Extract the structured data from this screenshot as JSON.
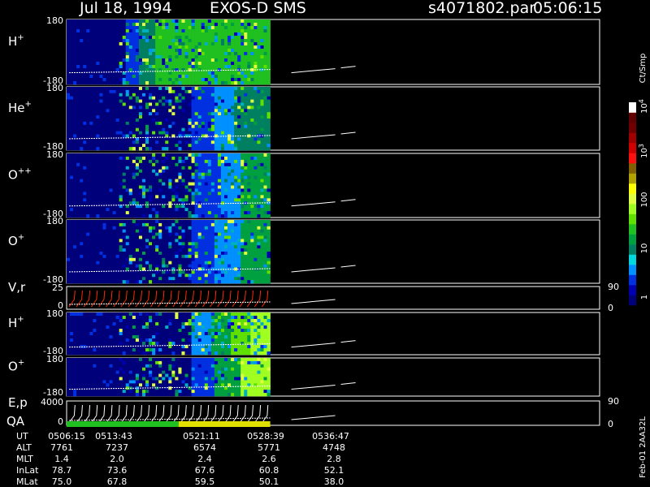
{
  "header": {
    "date": "Jul 18, 1994",
    "instrument": "EXOS-D SMS",
    "file": "s4071802.par",
    "time": "05:06:15"
  },
  "chart_data": {
    "type": "heatmap",
    "panels": [
      {
        "name": "H",
        "sup": "+",
        "ymax": "180",
        "ymin": "-180",
        "kind": "heat",
        "profile": "h1"
      },
      {
        "name": "He",
        "sup": "+",
        "ymax": "180",
        "ymin": "-180",
        "kind": "heat",
        "profile": "he"
      },
      {
        "name": "O",
        "sup": "++",
        "ymax": "180",
        "ymin": "-180",
        "kind": "heat",
        "profile": "opp"
      },
      {
        "name": "O",
        "sup": "+",
        "ymax": "180",
        "ymin": "-180",
        "kind": "heat",
        "profile": "op"
      },
      {
        "name": "V,r",
        "sup": "",
        "ymax": "25",
        "ymin": "0",
        "kind": "line",
        "right_top": "90",
        "right_bottom": "0"
      },
      {
        "name": "H",
        "sup": "+",
        "ymax": "180",
        "ymin": "-180",
        "kind": "heat",
        "profile": "h2"
      },
      {
        "name": "O",
        "sup": "+",
        "ymax": "180",
        "ymin": "-180",
        "kind": "heat",
        "profile": "o2"
      },
      {
        "name": "E,p",
        "sup": "",
        "ymax": "4000",
        "ymin": "0",
        "kind": "line",
        "right_top": "90",
        "right_bottom": "0"
      }
    ],
    "qa_label": "QA",
    "colorbar": {
      "unit": "Ct/Smp",
      "ticks": [
        {
          "label": "10",
          "exp": "4",
          "frac": 0.98
        },
        {
          "label": "10",
          "exp": "3",
          "frac": 0.76
        },
        {
          "label": "100",
          "exp": "",
          "frac": 0.52
        },
        {
          "label": "10",
          "exp": "",
          "frac": 0.28
        },
        {
          "label": "1",
          "exp": "",
          "frac": 0.04
        }
      ],
      "colors": [
        "#00007a",
        "#0000b0",
        "#0030e0",
        "#0090ff",
        "#00d8e0",
        "#008060",
        "#00a040",
        "#20c020",
        "#60e000",
        "#a0ff20",
        "#e0ff40",
        "#ffff00",
        "#b0a000",
        "#806000",
        "#ff1010",
        "#d00000",
        "#a00000",
        "#700000",
        "#600000",
        "#ffffff"
      ]
    },
    "ephemeris": {
      "labels": [
        "UT",
        "ALT",
        "MLT",
        "InLat",
        "MLat"
      ],
      "columns": [
        [
          "0506:15",
          "7761",
          "1.4",
          "78.7",
          "75.0"
        ],
        [
          "0513:43",
          "7237",
          "2.0",
          "73.6",
          "67.8"
        ],
        [
          "0521:11",
          "6574",
          "2.4",
          "67.6",
          "59.5"
        ],
        [
          "0528:39",
          "5771",
          "2.6",
          "60.8",
          "50.1"
        ],
        [
          "0536:47",
          "4748",
          "2.8",
          "52.1",
          "38.0"
        ]
      ]
    },
    "footer_code": "Feb-01 2AA32L",
    "data_end_fraction": 0.382
  }
}
